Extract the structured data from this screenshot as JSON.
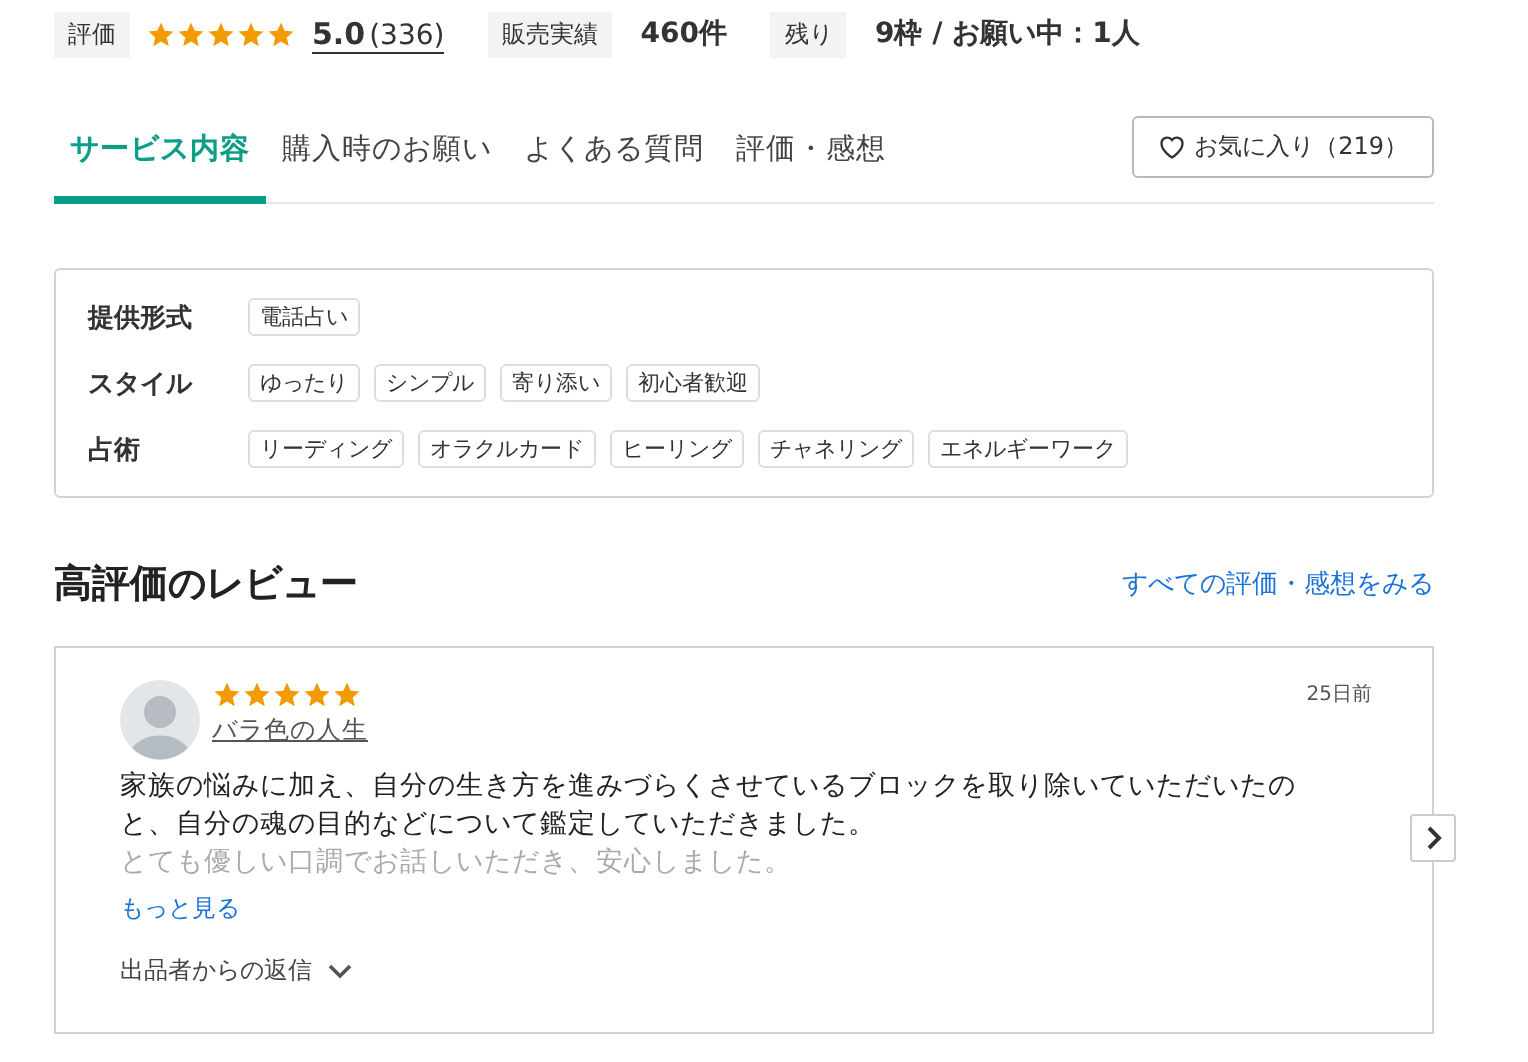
{
  "stats": {
    "rating_label": "評価",
    "stars": 5,
    "score": "5.0",
    "count": "(336)",
    "sales_label": "販売実績",
    "sales": "460件",
    "remaining_label": "残り",
    "remaining": "9枠 / お願い中：1人"
  },
  "tabs": [
    {
      "label": "サービス内容",
      "selected": true
    },
    {
      "label": "購入時のお願い",
      "selected": false
    },
    {
      "label": "よくある質問",
      "selected": false
    },
    {
      "label": "評価・感想",
      "selected": false
    }
  ],
  "favorite_button": {
    "label": "お気に入り（219）"
  },
  "attributes": [
    {
      "label": "提供形式",
      "tags": [
        "電話占い"
      ]
    },
    {
      "label": "スタイル",
      "tags": [
        "ゆったり",
        "シンプル",
        "寄り添い",
        "初心者歓迎"
      ]
    },
    {
      "label": "占術",
      "tags": [
        "リーディング",
        "オラクルカード",
        "ヒーリング",
        "チャネリング",
        "エネルギーワーク"
      ]
    }
  ],
  "reviews_section": {
    "title": "高評価のレビュー",
    "all_link": "すべての評価・感想をみる"
  },
  "review": {
    "stars": 5,
    "author": "バラ色の人生",
    "date": "25日前",
    "text": "家族の悩みに加え、自分の生き方を進みづらくさせているブロックを取り除いていただいたのと、自分の魂の目的などについて鑑定していただきました。",
    "text_faded": "とても優しい口調でお話しいただき、安心しました。",
    "more_link": "もっと見る",
    "reply_toggle": "出品者からの返信"
  }
}
